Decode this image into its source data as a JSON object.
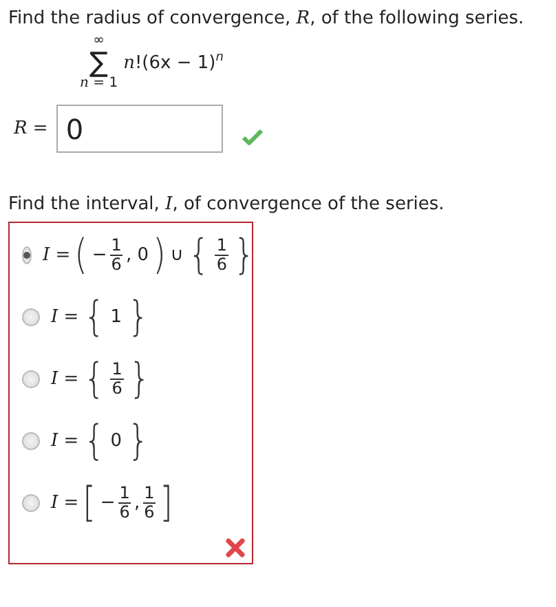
{
  "question_1": {
    "prompt": "Find the radius of convergence, *R*, of the following series.",
    "series": {
      "upper": "∞",
      "symbol": "∑",
      "lower": "*n* = 1",
      "term": "*n*!(6x − 1)$^{n}$"
    },
    "answer": {
      "label": "*R* =",
      "value": "0",
      "correct": true
    }
  },
  "question_2": {
    "prompt": "Find the interval, *I*, of convergence of the series.",
    "correct": false,
    "options": [
      {
        "selected": true,
        "parts": [
          {
            "kind": "text",
            "text": "*I* ="
          },
          {
            "kind": "delim",
            "text": "("
          },
          {
            "kind": "text",
            "text": "−"
          },
          {
            "kind": "frac",
            "num": "1",
            "den": "6"
          },
          {
            "kind": "text",
            "text": ", 0"
          },
          {
            "kind": "delim",
            "text": ")"
          },
          {
            "kind": "text",
            "text": "∪"
          },
          {
            "kind": "delim",
            "text": "{"
          },
          {
            "kind": "frac",
            "num": "1",
            "den": "6"
          },
          {
            "kind": "delim",
            "text": "}"
          }
        ]
      },
      {
        "selected": false,
        "parts": [
          {
            "kind": "text",
            "text": "*I* ="
          },
          {
            "kind": "delim",
            "text": "{"
          },
          {
            "kind": "text",
            "text": "1"
          },
          {
            "kind": "delim",
            "text": "}"
          }
        ]
      },
      {
        "selected": false,
        "parts": [
          {
            "kind": "text",
            "text": "*I* ="
          },
          {
            "kind": "delim",
            "text": "{"
          },
          {
            "kind": "frac",
            "num": "1",
            "den": "6"
          },
          {
            "kind": "delim",
            "text": "}"
          }
        ]
      },
      {
        "selected": false,
        "parts": [
          {
            "kind": "text",
            "text": "*I* ="
          },
          {
            "kind": "delim",
            "text": "{"
          },
          {
            "kind": "text",
            "text": "0"
          },
          {
            "kind": "delim",
            "text": "}"
          }
        ]
      },
      {
        "selected": false,
        "parts": [
          {
            "kind": "text",
            "text": "*I* ="
          },
          {
            "kind": "delim",
            "text": "["
          },
          {
            "kind": "text",
            "text": "−"
          },
          {
            "kind": "frac",
            "num": "1",
            "den": "6"
          },
          {
            "kind": "text",
            "text": ","
          },
          {
            "kind": "frac",
            "num": "1",
            "den": "6"
          },
          {
            "kind": "delim",
            "text": "]"
          }
        ]
      }
    ]
  }
}
